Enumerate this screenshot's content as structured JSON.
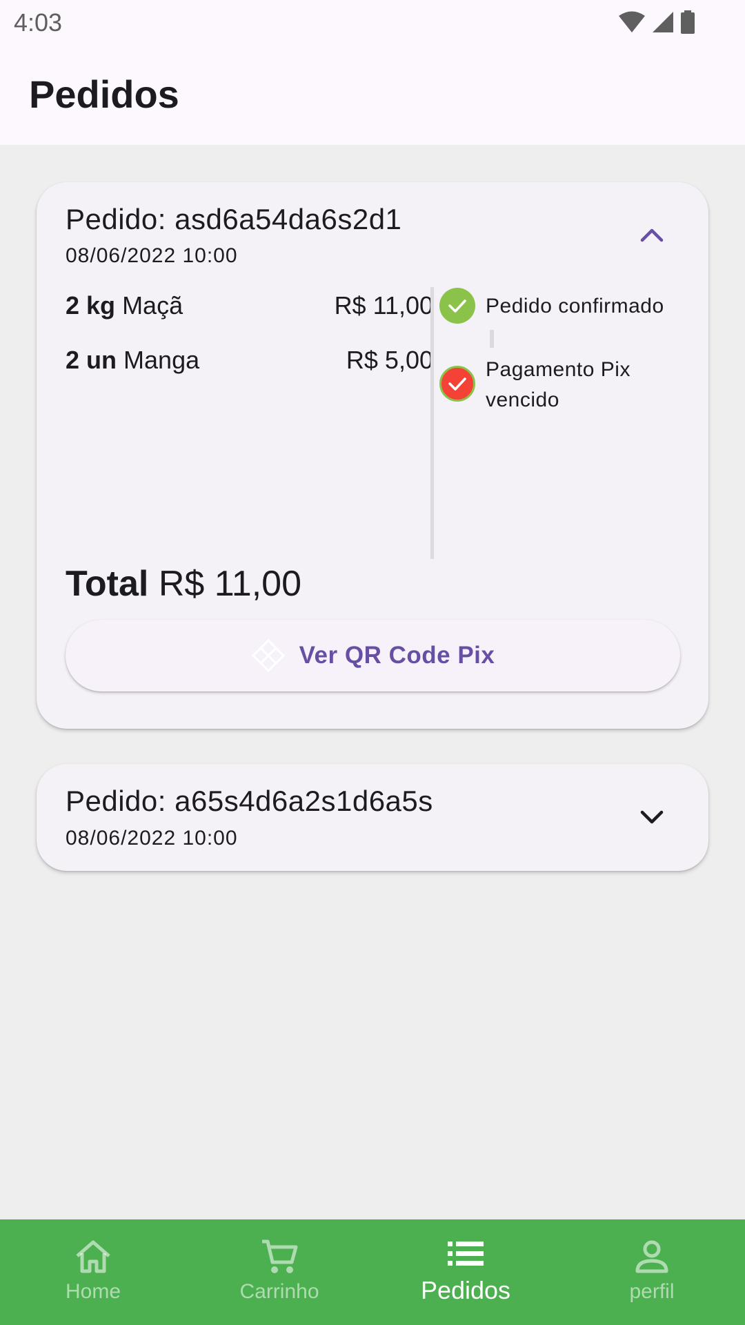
{
  "status_bar": {
    "time": "4:03"
  },
  "app_bar": {
    "title": "Pedidos"
  },
  "orders": [
    {
      "id_label": "Pedido: asd6a54da6s2d1",
      "date": "08/06/2022 10:00",
      "expanded": true,
      "items": [
        {
          "qty": "2 kg",
          "name": "Maçã",
          "price": "R$ 11,00"
        },
        {
          "qty": "2 un",
          "name": "Manga",
          "price": "R$ 5,00"
        }
      ],
      "timeline": [
        {
          "label": "Pedido confirmado",
          "color": "#8bc34a",
          "icon": "check-icon"
        },
        {
          "label": "Pagamento Pix vencido",
          "color": "#f44336",
          "icon": "check-icon"
        }
      ],
      "total_label": "Total",
      "total_value": "R$ 11,00",
      "qr_button_label": "Ver QR Code Pix"
    },
    {
      "id_label": "Pedido: a65s4d6a2s1d6a5s",
      "date": "08/06/2022 10:00",
      "expanded": false
    }
  ],
  "bottom_nav": {
    "items": [
      {
        "label": "Home",
        "icon": "home-icon",
        "active": false
      },
      {
        "label": "Carrinho",
        "icon": "cart-icon",
        "active": false
      },
      {
        "label": "Pedidos",
        "icon": "list-icon",
        "active": true
      },
      {
        "label": "perfil",
        "icon": "person-icon",
        "active": false
      }
    ]
  },
  "colors": {
    "accent": "#6750a4",
    "nav_background": "#4caf50",
    "success": "#8bc34a",
    "error": "#f44336"
  }
}
